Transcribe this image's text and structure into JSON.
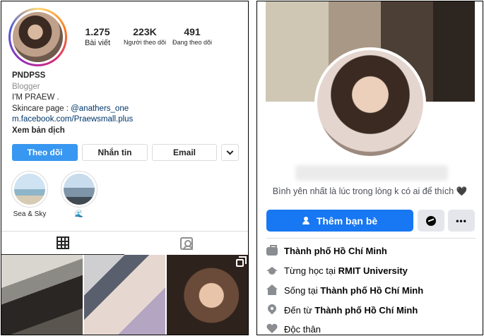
{
  "instagram": {
    "stats": [
      {
        "value": "1.275",
        "label": "Bài viết"
      },
      {
        "value": "223K",
        "label": "Người theo dõi"
      },
      {
        "value": "491",
        "label": "Đang theo dõi"
      }
    ],
    "bio": {
      "username": "PNDPSS",
      "category": "Blogger",
      "line1": "I'M PRAEW .",
      "line2_prefix": "Skincare page : ",
      "line2_mention": "@anathers_one",
      "link": "m.facebook.com/Praewsmall.plus",
      "translate": "Xem bản dịch"
    },
    "buttons": {
      "follow": "Theo dõi",
      "message": "Nhắn tin",
      "email": "Email"
    },
    "highlights": [
      {
        "label": "Sea & Sky"
      },
      {
        "label": "🌊"
      }
    ],
    "icons": {
      "grid_tab": "grid-icon",
      "tagged_tab": "tagged-icon",
      "multi_post": "multiple-posts-icon",
      "dropdown": "chevron-down-icon"
    },
    "colors": {
      "follow_button": "#3897f0",
      "link": "#00376b"
    }
  },
  "facebook": {
    "bio": "Bình yên nhất là lúc trong lòng k có ai để thích 🖤",
    "buttons": {
      "add_friend": "Thêm bạn bè",
      "more": "•••"
    },
    "intro": [
      {
        "prefix": "",
        "bold": "Thành phố Hồ Chí Minh",
        "icon": "work-icon"
      },
      {
        "prefix": "Từng học tại ",
        "bold": "RMIT University",
        "icon": "school-icon"
      },
      {
        "prefix": "Sống tại ",
        "bold": "Thành phố Hồ Chí Minh",
        "icon": "home-icon"
      },
      {
        "prefix": "Đến từ ",
        "bold": "Thành phố Hồ Chí Minh",
        "icon": "pin-icon"
      },
      {
        "prefix": "Độc thân",
        "bold": "",
        "icon": "heart-icon"
      }
    ],
    "colors": {
      "primary_button": "#1877f2",
      "secondary_button": "#e4e6eb"
    }
  }
}
